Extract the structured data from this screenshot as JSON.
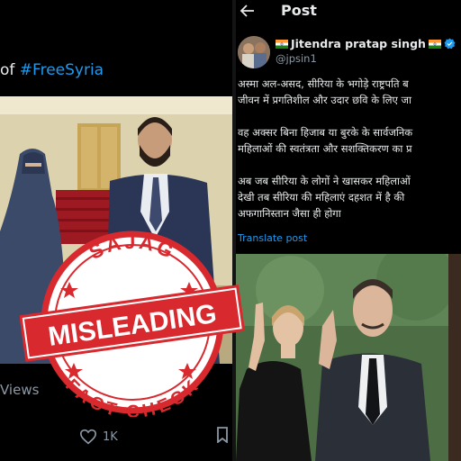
{
  "left_tweet": {
    "text_prefix": "of ",
    "hashtag": "#FreeSyria",
    "views_label": "Views",
    "likes_count": "1K"
  },
  "post": {
    "header_title": "Post",
    "author_name": "Jitendra pratap singh",
    "author_handle": "@jpsin1",
    "paragraphs": [
      [
        "अस्मा अल-असद, सीरिया के भगोड़े राष्ट्रपति ब",
        "जीवन में प्रगतिशील और उदार छवि के लिए जा"
      ],
      [
        "वह अक्सर बिना हिजाब या बुरके के सार्वजनिक",
        "महिलाओं की स्वतंत्रता और सशक्तिकरण का प्र"
      ],
      [
        "अब जब सीरिया के लोगों ने खासकर महिलाओं",
        "देखी तब सीरिया की महिलाएं दहशत में है की",
        "अफगानिस्तान जैसा ही होगा"
      ]
    ],
    "translate_label": "Translate post"
  },
  "stamp": {
    "top_text": "SAJAG",
    "main_text": "MISLEADING",
    "bottom_text": "FACT CHECK"
  },
  "colors": {
    "link": "#1d9bf0",
    "stamp_red": "#d8292f",
    "muted": "#8b98a5",
    "verified": "#1d9bf0"
  }
}
